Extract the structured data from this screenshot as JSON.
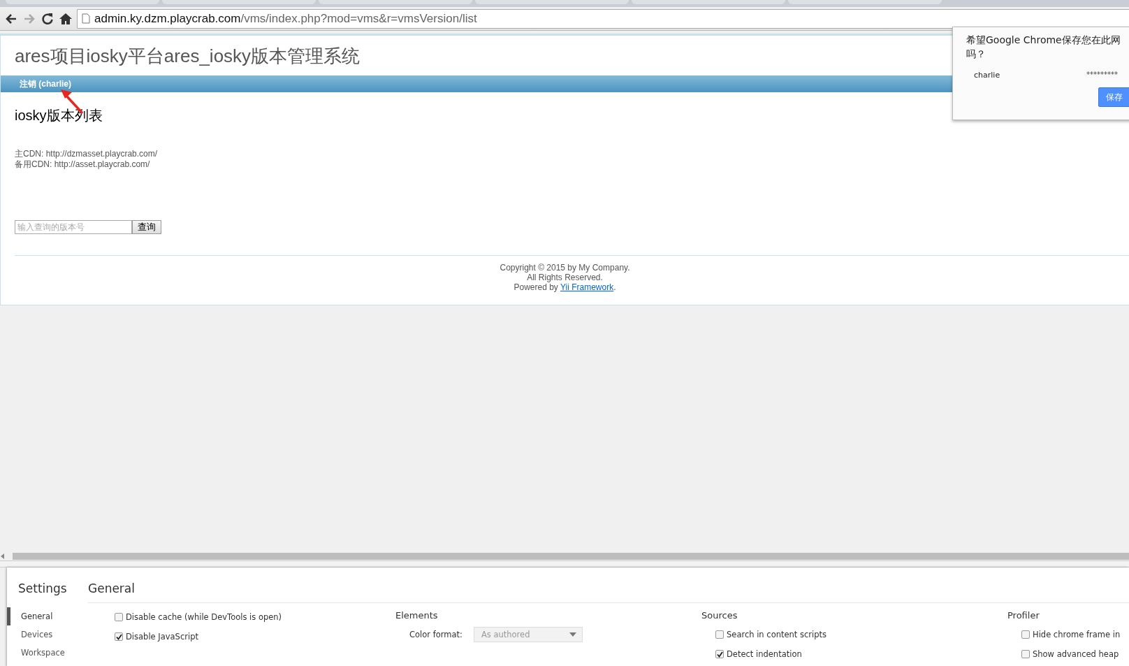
{
  "browser": {
    "url_host": "admin.ky.dzm.playcrab.com",
    "url_path": "/vms/index.php?mod=vms&r=vmsVersion/list"
  },
  "page": {
    "title": "ares项目iosky平台ares_iosky版本管理系统",
    "menu": [
      {
        "label": "注销 (charlie)"
      }
    ],
    "heading": "iosky版本列表",
    "cdn_lines": [
      "主CDN: http://dzmasset.playcrab.com/",
      "备用CDN: http://asset.playcrab.com/"
    ],
    "search": {
      "placeholder": "输入查询的版本号",
      "button": "查询"
    },
    "footer": {
      "lines": [
        "Copyright © 2015 by My Company.",
        "All Rights Reserved."
      ],
      "powered_prefix": "Powered by ",
      "link": "Yii Framework",
      "suffix": "."
    }
  },
  "password_prompt": {
    "question_line_1": "希望Google Chrome保存您在此网",
    "question_line_2": "吗？",
    "username": "charlie",
    "password": "*********",
    "button": "保存"
  },
  "devtools": {
    "settings": {
      "title": "Settings",
      "nav": [
        {
          "label": "General",
          "selected": true
        },
        {
          "label": "Devices",
          "selected": false
        },
        {
          "label": "Workspace",
          "selected": false
        }
      ],
      "heading": "General",
      "sections": [
        {
          "items": [
            {
              "kind": "checkbox",
              "label": "Disable cache (while DevTools is open)",
              "checked": false
            },
            {
              "kind": "checkbox",
              "label": "Disable JavaScript",
              "checked": true
            }
          ]
        },
        {
          "title": "Elements",
          "items": [
            {
              "kind": "select",
              "label": "Color format:",
              "value": "As authored"
            }
          ]
        },
        {
          "title": "Sources",
          "items": [
            {
              "kind": "checkbox",
              "label": "Search in content scripts",
              "checked": false
            },
            {
              "kind": "checkbox",
              "label": "Detect indentation",
              "checked": true
            }
          ]
        },
        {
          "title": "Profiler",
          "items": [
            {
              "kind": "checkbox",
              "label": "Hide chrome frame in",
              "checked": false
            },
            {
              "kind": "checkbox",
              "label": "Show advanced heap",
              "checked": false
            }
          ]
        }
      ]
    }
  }
}
